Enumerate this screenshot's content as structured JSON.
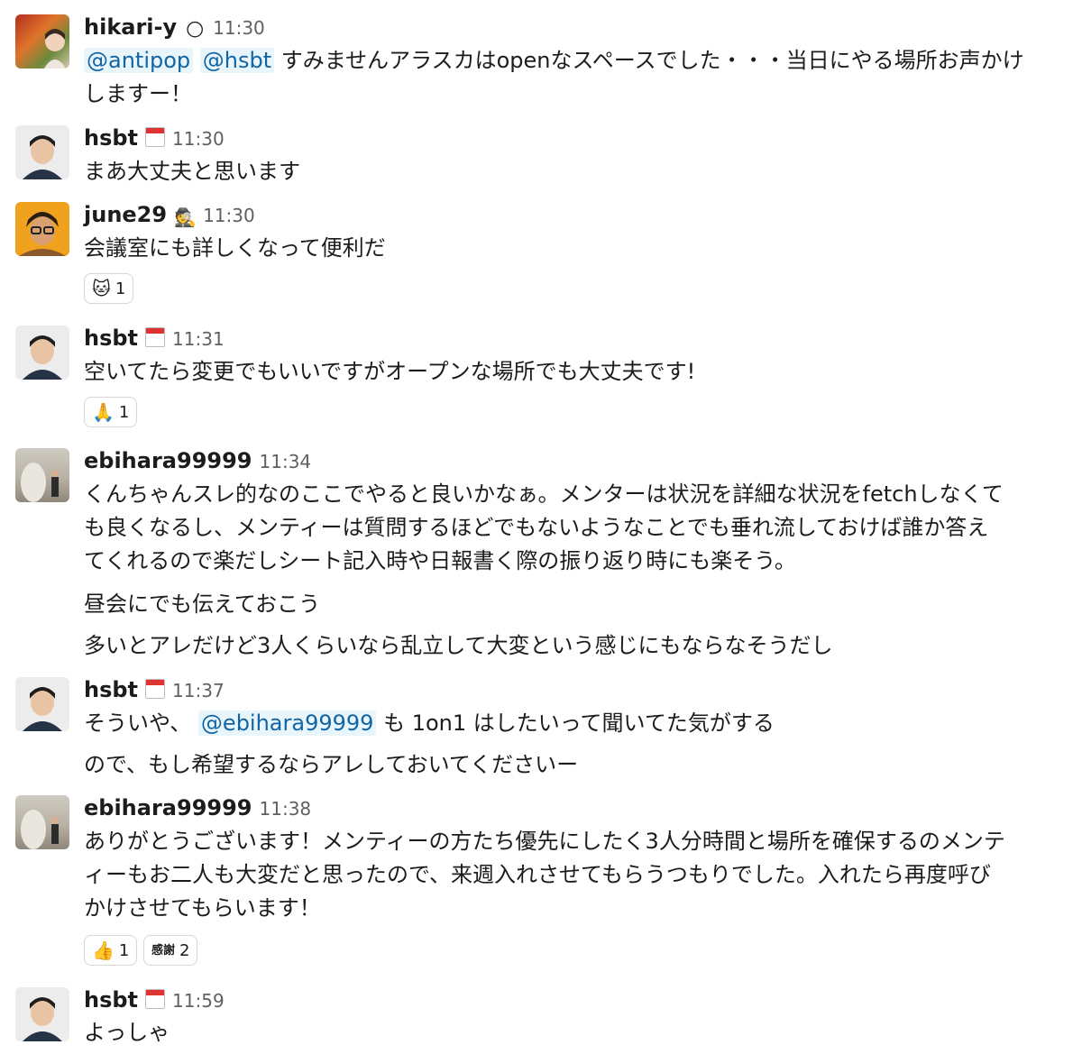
{
  "messages": [
    {
      "user": "hikari-y",
      "status_icon": "🌕",
      "time": "11:30",
      "mentions": [
        "@antipop",
        "@hsbt"
      ],
      "text_main": " すみませんアラスカはopenなスペースでした・・・当日にやる場所お声かけ",
      "text_cont": "しますー！"
    },
    {
      "user": "hsbt",
      "status_icon": "calendar-icon",
      "time": "11:30",
      "text": "まあ大丈夫と思います"
    },
    {
      "user": "june29",
      "status_icon": "🕵",
      "time": "11:30",
      "text": "会議室にも詳しくなって便利だ",
      "reactions": [
        {
          "emoji": "🐱",
          "count": "1"
        }
      ]
    },
    {
      "user": "hsbt",
      "status_icon": "calendar-icon",
      "time": "11:31",
      "text": "空いてたら変更でもいいですがオープンな場所でも大丈夫です!",
      "reactions": [
        {
          "emoji": "🙏",
          "count": "1"
        }
      ]
    },
    {
      "user": "ebihara99999",
      "time": "11:34",
      "lines": [
        "くんちゃんスレ的なのここでやると良いかなぁ。メンターは状況を詳細な状況をfetchしなくて",
        "も良くなるし、メンティーは質問するほどでもないようなことでも垂れ流しておけば誰か答え",
        "てくれるので楽だしシート記入時や日報書く際の振り返り時にも楽そう。"
      ],
      "extra1": "昼会にでも伝えておこう",
      "extra2": "多いとアレだけど3人くらいなら乱立して大変という感じにもならなそうだし"
    },
    {
      "user": "hsbt",
      "status_icon": "calendar-icon",
      "time": "11:37",
      "text_pre": "そういや、 ",
      "mention": "@ebihara99999",
      "text_post": " も 1on1 はしたいって聞いてた気がする",
      "extra": "ので、もし希望するならアレしておいてくださいー"
    },
    {
      "user": "ebihara99999",
      "time": "11:38",
      "lines": [
        "ありがとうございます！メンティーの方たち優先にしたく3人分時間と場所を確保するのメンテ",
        "ィーもお二人も大変だと思ったので、来週入れさせてもらうつもりでした。入れたら再度呼び",
        "かけさせてもらいます！"
      ],
      "reactions": [
        {
          "emoji": "👍",
          "count": "1"
        },
        {
          "emoji": "感謝",
          "count": "2"
        }
      ]
    },
    {
      "user": "hsbt",
      "status_icon": "calendar-icon",
      "time": "11:59",
      "text": "よっしゃ"
    }
  ]
}
